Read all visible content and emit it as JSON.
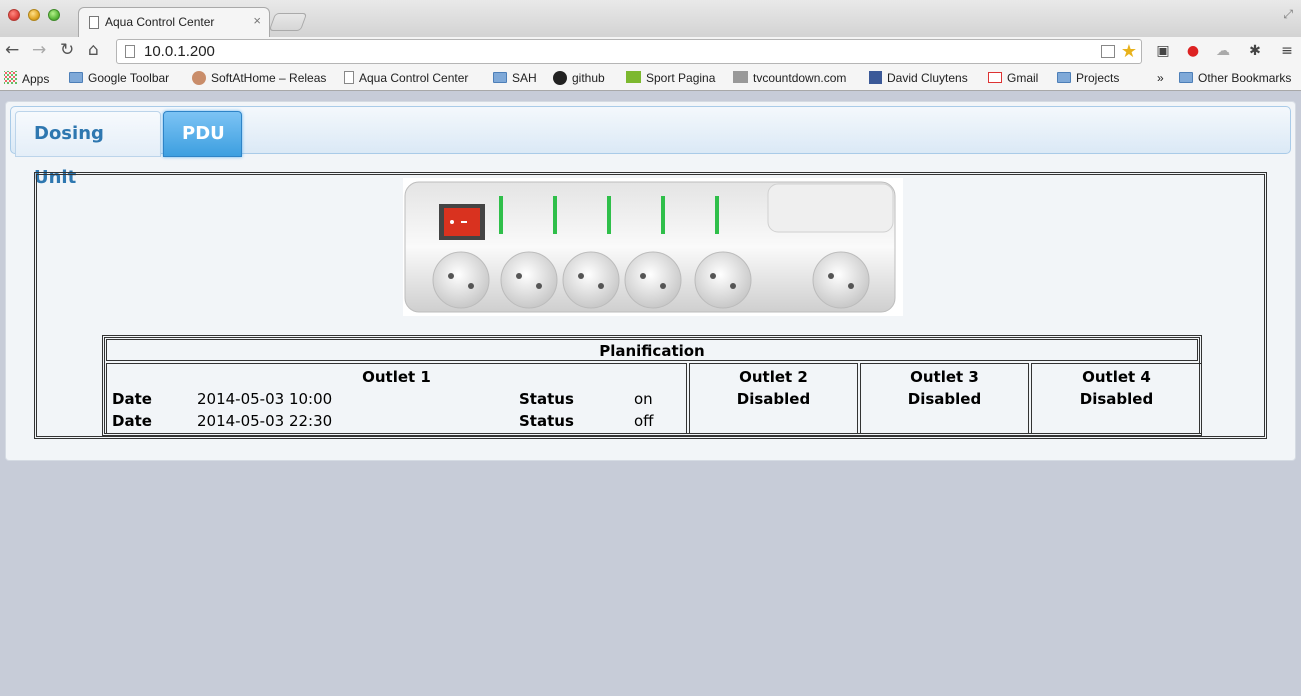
{
  "browser": {
    "tab_title": "Aqua Control Center",
    "tab_close": "×",
    "url": "10.0.1.200",
    "bookmarks": [
      {
        "label": "Apps",
        "icon": "apps-icon"
      },
      {
        "label": "Google Toolbar",
        "icon": "folder-icon"
      },
      {
        "label": "SoftAtHome – Releas",
        "icon": "avatar-icon"
      },
      {
        "label": "Aqua Control Center",
        "icon": "page-icon"
      },
      {
        "label": "SAH",
        "icon": "folder-icon"
      },
      {
        "label": "github",
        "icon": "github-icon"
      },
      {
        "label": "Sport Pagina",
        "icon": "msp-icon"
      },
      {
        "label": "tvcountdown.com",
        "icon": "tv-icon"
      },
      {
        "label": "David Cluytens",
        "icon": "facebook-icon"
      },
      {
        "label": "Gmail",
        "icon": "gmail-icon"
      },
      {
        "label": "Projects",
        "icon": "folder-icon"
      },
      {
        "label": "»",
        "icon": ""
      },
      {
        "label": "Other Bookmarks",
        "icon": "folder-icon"
      }
    ]
  },
  "tabs": {
    "dosing": "Dosing Unit",
    "pdu": "PDU",
    "active": "PDU"
  },
  "pdu_image": {
    "icon": "power-strip-image",
    "switch_color": "#d9321f",
    "led_color": "#2fbf4a"
  },
  "planification": {
    "title": "Planification",
    "outlet1": {
      "title": "Outlet 1",
      "rows": [
        {
          "date_label": "Date",
          "date": "2014-05-03 10:00",
          "status_label": "Status",
          "status": "on"
        },
        {
          "date_label": "Date",
          "date": "2014-05-03 22:30",
          "status_label": "Status",
          "status": "off"
        }
      ]
    },
    "outlet2": {
      "title": "Outlet 2",
      "status": "Disabled"
    },
    "outlet3": {
      "title": "Outlet 3",
      "status": "Disabled"
    },
    "outlet4": {
      "title": "Outlet 4",
      "status": "Disabled"
    }
  },
  "colors": {
    "tab_active": "#3d9fe0",
    "tab_inactive_text": "#2e77b0",
    "page_bg": "#c7ccd8"
  }
}
